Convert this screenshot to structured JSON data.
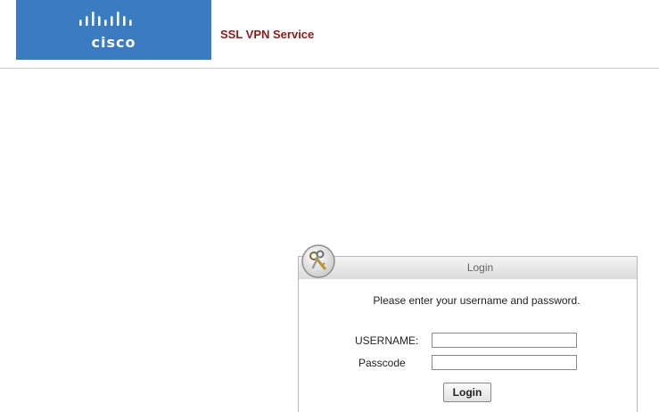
{
  "header": {
    "logo_text": "cisco",
    "service_title": "SSL VPN Service"
  },
  "login": {
    "title": "Login",
    "instruction": "Please enter your username and password.",
    "username_label": "USERNAME:",
    "username_value": "",
    "passcode_label": "Passcode",
    "passcode_value": "",
    "button_label": "Login"
  },
  "icons": {
    "login_icon": "keys-icon",
    "logo_mark": "cisco-bars-logo"
  },
  "colors": {
    "logo_background": "#3b7bbf",
    "service_title": "#8b1a1a"
  }
}
